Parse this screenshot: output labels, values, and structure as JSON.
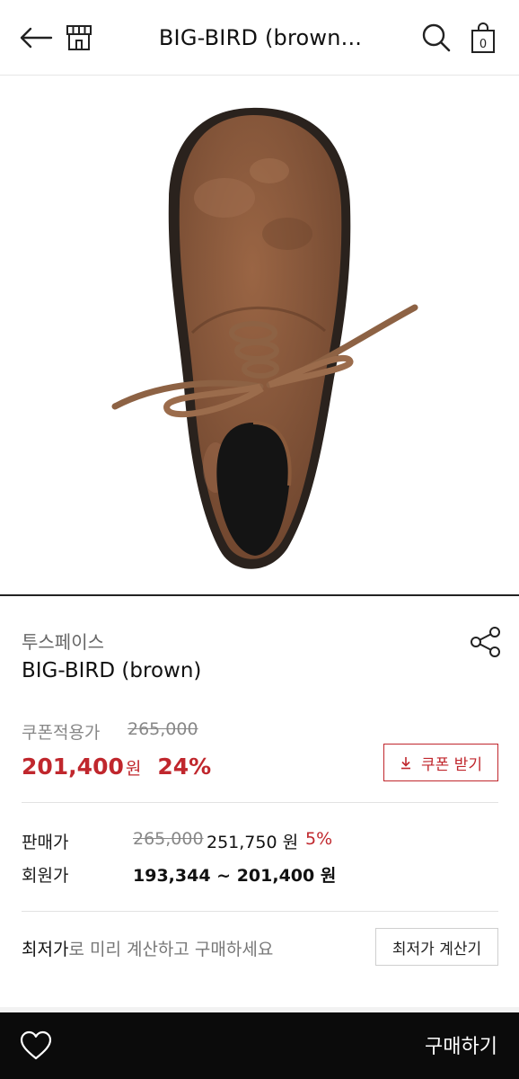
{
  "header": {
    "title": "BIG-BIRD (brown..."
  },
  "cart": {
    "count": "0"
  },
  "product": {
    "brand": "투스페이스",
    "name": "BIG-BIRD (brown)"
  },
  "coupon": {
    "label": "쿠폰적용가",
    "original_price": "265,000",
    "price": "201,400",
    "currency": "원",
    "discount": "24%",
    "button_label": "쿠폰 받기"
  },
  "sale": {
    "label": "판매가",
    "original_price": "265,000",
    "price": "251,750 원",
    "discount": "5%"
  },
  "member": {
    "label": "회원가",
    "price_range": "193,344 ~ 201,400 원"
  },
  "calc": {
    "text_bold": "최저가",
    "text_rest": "로 미리 계산하고 구매하세요",
    "button_label": "최저가 계산기"
  },
  "bottom": {
    "buy_label": "구매하기"
  },
  "colors": {
    "accent_red": "#c0272d",
    "bottom_bar": "#0b0b0b",
    "suede_brown": "#8a5a3b"
  },
  "icons": {
    "back": "back-arrow-icon",
    "store": "store-icon",
    "search": "search-icon",
    "cart": "shopping-bag-icon",
    "share": "share-icon",
    "download": "download-icon",
    "wishlist": "heart-icon"
  }
}
